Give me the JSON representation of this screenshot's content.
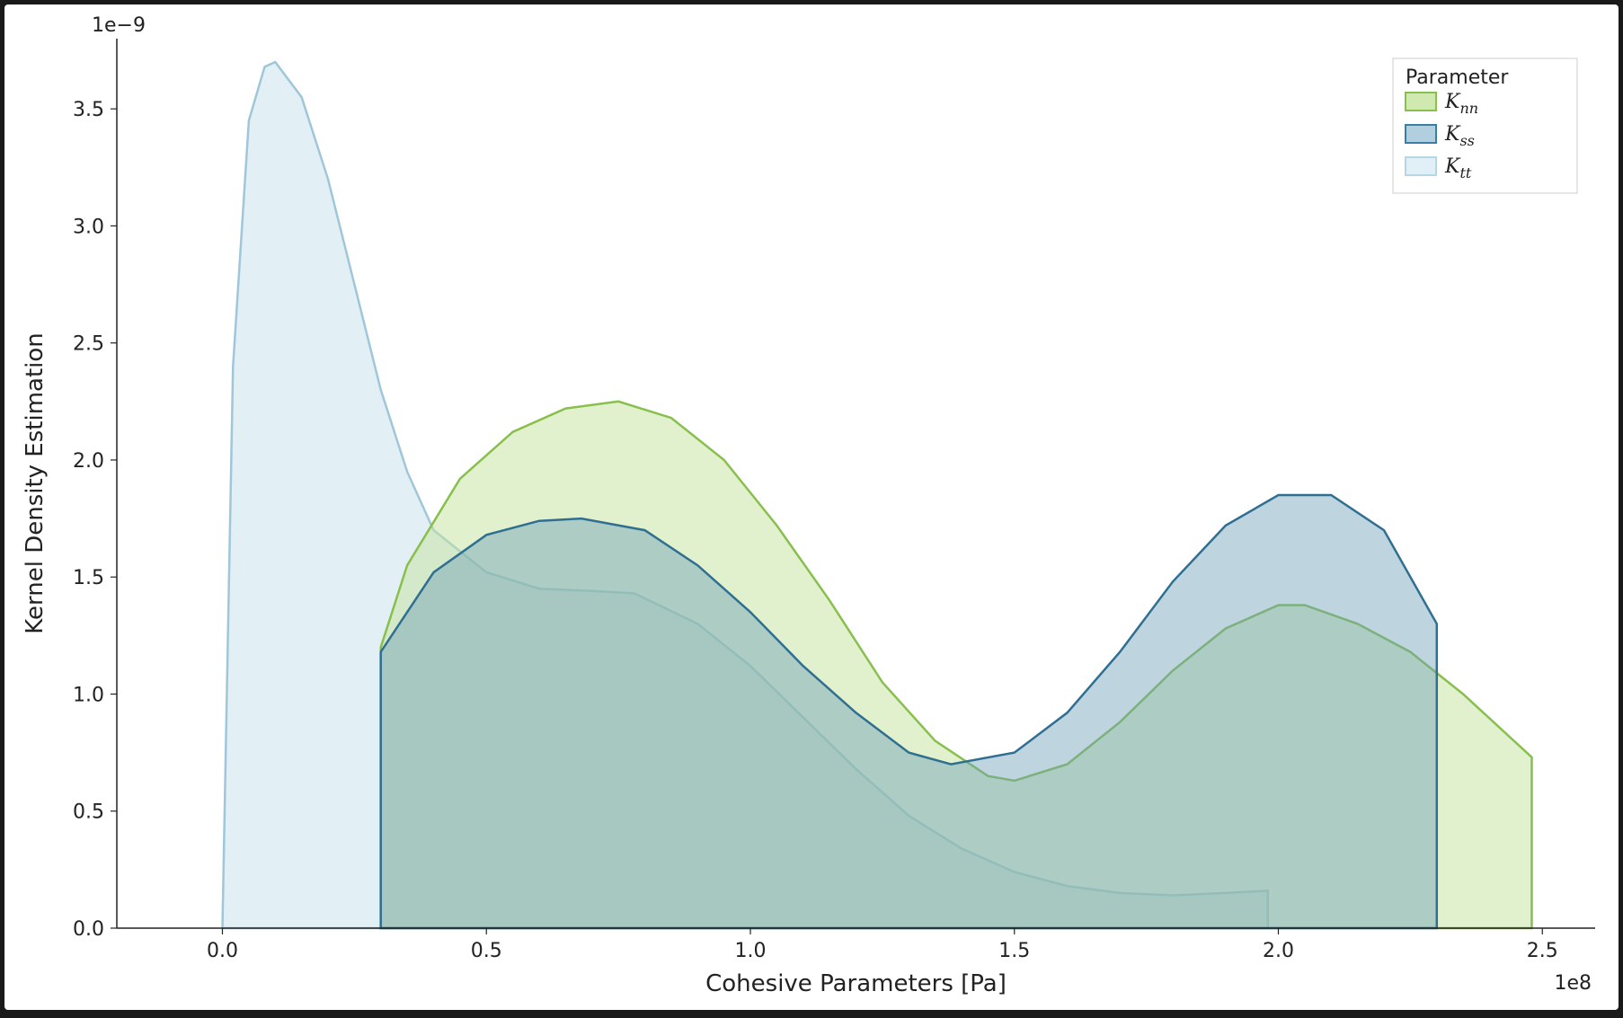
{
  "chart_data": {
    "type": "area",
    "title": "",
    "xlabel": "Cohesive Parameters [Pa]",
    "ylabel": "Kernel Density Estimation",
    "x_offset_text": "1e8",
    "y_offset_text": "1e−9",
    "xlim": [
      -0.2,
      2.6
    ],
    "ylim": [
      0.0,
      3.8
    ],
    "xticks": [
      0.0,
      0.5,
      1.0,
      1.5,
      2.0,
      2.5
    ],
    "yticks": [
      0.0,
      0.5,
      1.0,
      1.5,
      2.0,
      2.5,
      3.0,
      3.5
    ],
    "xtick_labels": [
      "0.0",
      "0.5",
      "1.0",
      "1.5",
      "2.0",
      "2.5"
    ],
    "ytick_labels": [
      "0.0",
      "0.5",
      "1.0",
      "1.5",
      "2.0",
      "2.5",
      "3.0",
      "3.5"
    ],
    "legend": {
      "title": "Parameter",
      "position": "upper right",
      "entries": [
        "K_nn",
        "K_ss",
        "K_tt"
      ]
    },
    "series": [
      {
        "name": "K_nn",
        "color_fill": "#c3e39e",
        "color_stroke": "#88bf4d",
        "fill_opacity": 0.5,
        "x": [
          0.3,
          0.35,
          0.45,
          0.55,
          0.65,
          0.75,
          0.85,
          0.95,
          1.05,
          1.15,
          1.25,
          1.35,
          1.45,
          1.5,
          1.6,
          1.7,
          1.8,
          1.9,
          2.0,
          2.05,
          2.15,
          2.25,
          2.35,
          2.48
        ],
        "y": [
          1.2,
          1.55,
          1.92,
          2.12,
          2.22,
          2.25,
          2.18,
          2.0,
          1.72,
          1.4,
          1.05,
          0.8,
          0.65,
          0.63,
          0.7,
          0.88,
          1.1,
          1.28,
          1.38,
          1.38,
          1.3,
          1.18,
          1.0,
          0.73
        ]
      },
      {
        "name": "K_ss",
        "color_fill": "#6f9fb7",
        "color_stroke": "#2f6f91",
        "fill_opacity": 0.45,
        "x": [
          0.3,
          0.4,
          0.5,
          0.6,
          0.68,
          0.8,
          0.9,
          1.0,
          1.1,
          1.2,
          1.3,
          1.38,
          1.5,
          1.6,
          1.7,
          1.8,
          1.9,
          2.0,
          2.1,
          2.2,
          2.3
        ],
        "y": [
          1.18,
          1.52,
          1.68,
          1.74,
          1.75,
          1.7,
          1.55,
          1.35,
          1.12,
          0.92,
          0.75,
          0.7,
          0.75,
          0.92,
          1.18,
          1.48,
          1.72,
          1.85,
          1.85,
          1.7,
          1.3
        ]
      },
      {
        "name": "K_tt",
        "color_fill": "#cfe4ef",
        "color_stroke": "#9fc7d9",
        "fill_opacity": 0.6,
        "x": [
          0.0,
          0.02,
          0.05,
          0.08,
          0.1,
          0.15,
          0.2,
          0.25,
          0.3,
          0.35,
          0.4,
          0.5,
          0.6,
          0.7,
          0.78,
          0.9,
          1.0,
          1.1,
          1.2,
          1.3,
          1.4,
          1.5,
          1.6,
          1.7,
          1.8,
          1.9,
          1.98,
          1.98
        ],
        "y": [
          0.0,
          2.4,
          3.45,
          3.68,
          3.7,
          3.55,
          3.2,
          2.75,
          2.3,
          1.95,
          1.7,
          1.52,
          1.45,
          1.44,
          1.43,
          1.3,
          1.12,
          0.9,
          0.68,
          0.48,
          0.34,
          0.24,
          0.18,
          0.15,
          0.14,
          0.15,
          0.16,
          0.0
        ]
      }
    ]
  }
}
